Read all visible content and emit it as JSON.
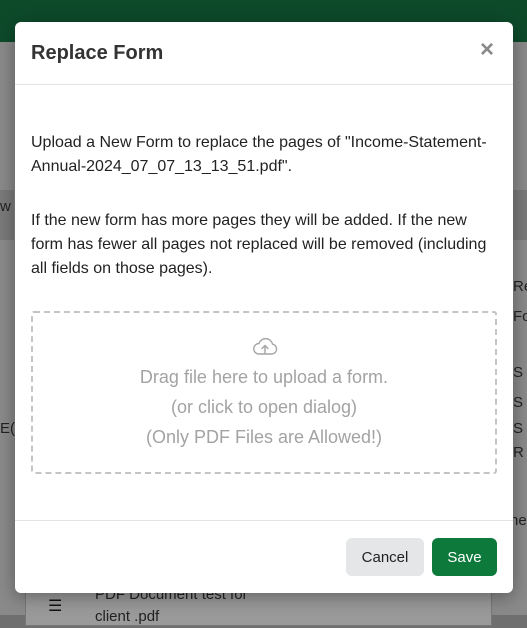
{
  "modal": {
    "title": "Replace Form",
    "close_glyph": "×",
    "paragraph1": "Upload a New Form to replace the pages of \"Income-Statement-Annual-2024_07_07_13_13_51.pdf\".",
    "paragraph2": "If the new form has more pages they will be added. If the new form has fewer all pages not replaced will be removed (including all fields on those pages).",
    "dropzone": {
      "icon": "cloud-upload-icon",
      "line1": "Drag file here to upload a form.",
      "line2": "(or click to open dialog)",
      "line3": "(Only PDF Files are Allowed!)"
    },
    "cancel_label": "Cancel",
    "save_label": "Save"
  },
  "background": {
    "doc_title_line1": "PDF Document test for",
    "doc_title_line2": "client .pdf",
    "menu_icon": "hamburger-menu-icon",
    "fragments": [
      "w",
      "Re",
      "Fo",
      "S F",
      "S",
      "E(",
      "S M",
      "R",
      "ne"
    ]
  },
  "colors": {
    "topbar": "#0d4a2a",
    "save_button": "#0d7a3c",
    "cancel_button": "#e4e6e7",
    "dropzone_text": "#a3a3a3"
  }
}
